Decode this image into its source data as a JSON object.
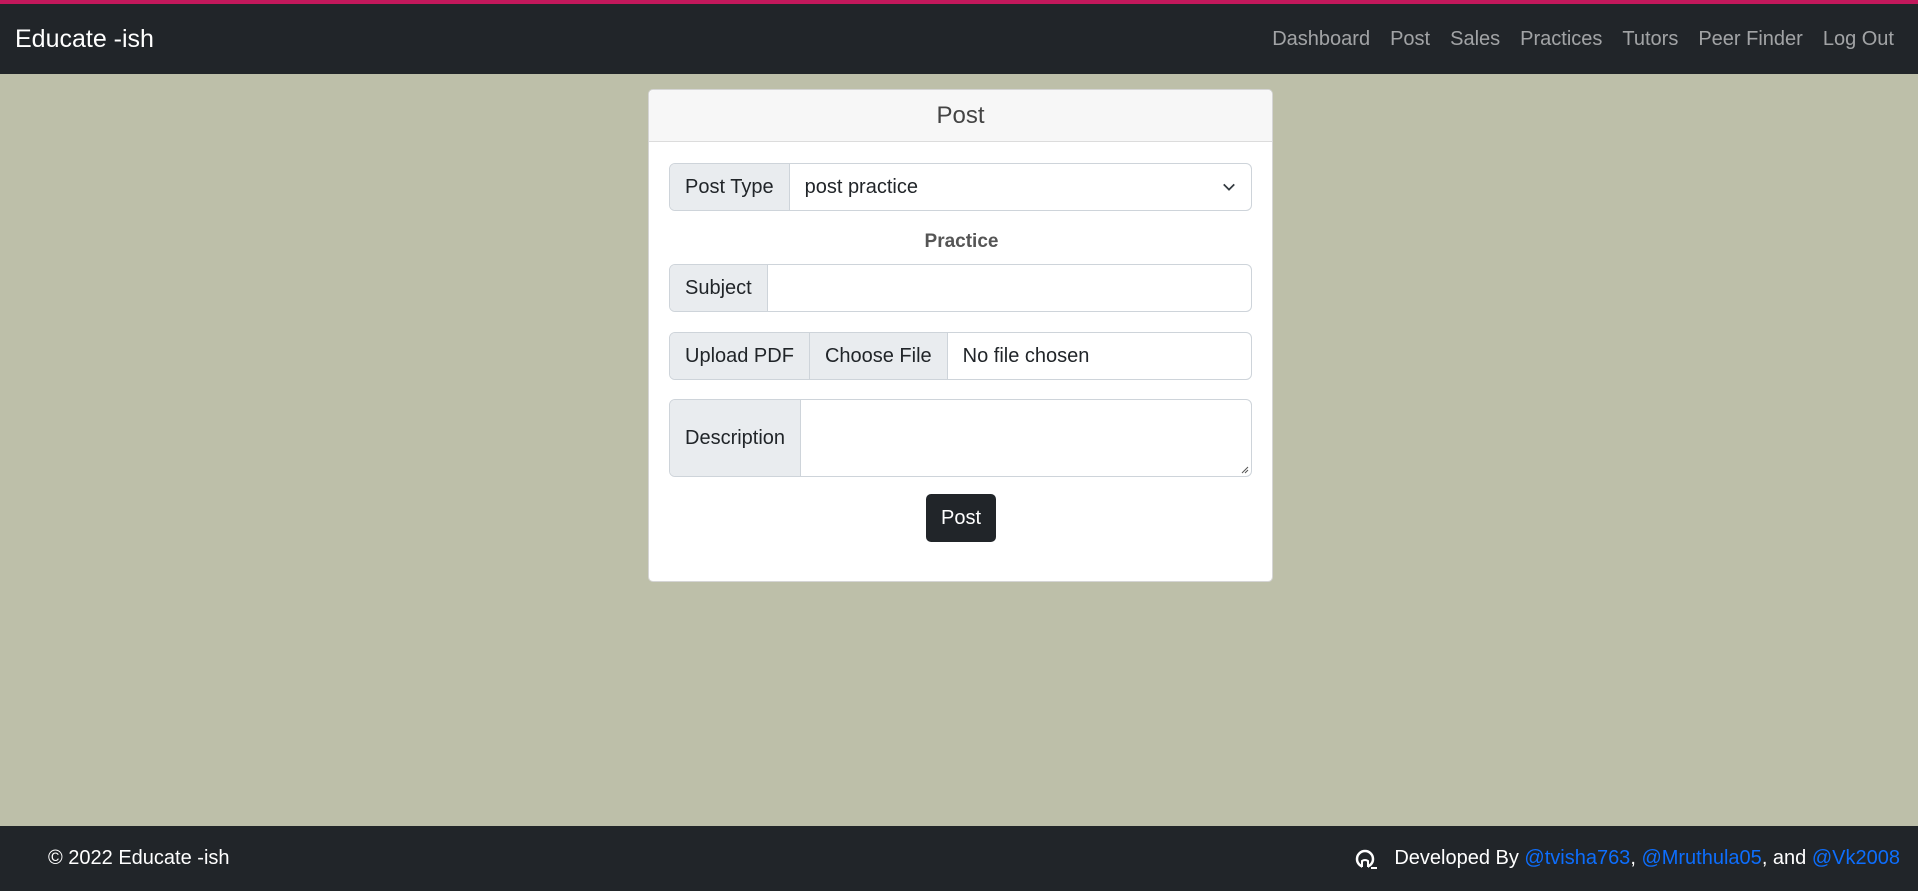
{
  "app": {
    "brand": "Educate -ish"
  },
  "nav": {
    "items": [
      "Dashboard",
      "Post",
      "Sales",
      "Practices",
      "Tutors",
      "Peer Finder",
      "Log Out"
    ]
  },
  "card": {
    "title": "Post",
    "post_type": {
      "label": "Post Type",
      "value": "post practice"
    },
    "section_title": "Practice",
    "subject": {
      "label": "Subject",
      "value": ""
    },
    "upload": {
      "label": "Upload PDF",
      "button": "Choose File",
      "status": "No file chosen"
    },
    "description": {
      "label": "Description",
      "value": ""
    },
    "submit": "Post"
  },
  "footer": {
    "copyright": "© 2022 Educate -ish",
    "developed_by": "Developed By ",
    "dev1": "@tvisha763",
    "sep1": ", ",
    "dev2": "@Mruthula05",
    "sep2": ", and ",
    "dev3": "@Vk2008",
    "icon": "github-icon"
  },
  "colors": {
    "navbar": "#212529",
    "background": "#bdbfa9",
    "accent_line": "#c2185b",
    "link": "#0d6efd"
  }
}
